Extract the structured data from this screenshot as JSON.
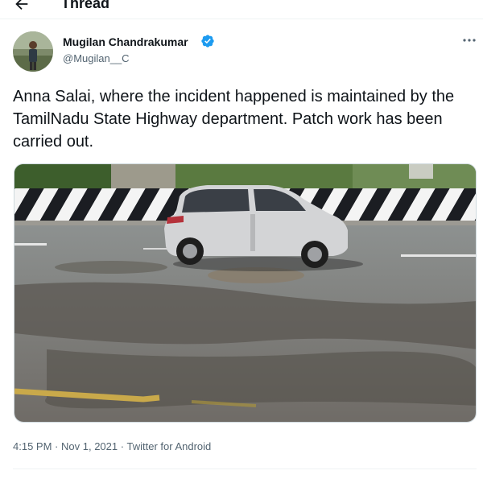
{
  "header": {
    "title": "Thread",
    "back_icon": "arrow-left-icon"
  },
  "tweet": {
    "author": {
      "name": "Mugilan Chandrakumar",
      "handle": "@Mugilan__C",
      "verified": true,
      "verified_color": "#1d9bf0"
    },
    "text": "Anna Salai, where the incident happened is maintained by the TamilNadu State Highway department. Patch work has been carried out.",
    "time": "4:15 PM",
    "separator": "·",
    "date": "Nov 1, 2021",
    "source": "Twitter for Android"
  },
  "colors": {
    "text": "#0f1419",
    "secondary": "#536471",
    "accent": "#1d9bf0"
  }
}
